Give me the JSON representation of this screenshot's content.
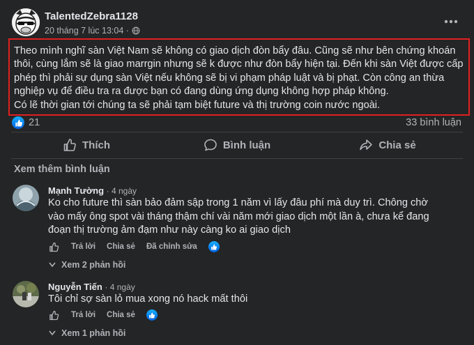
{
  "post": {
    "author": "TalentedZebra1128",
    "timestamp": "20 tháng 7 lúc 13:04 ·",
    "privacy_icon": "globe-icon",
    "more_icon": "more-horizontal-icon",
    "text_lines": [
      "Theo mình nghĩ sàn Việt Nam sẽ không có giao dịch đòn bẩy đâu. Cũng sẽ như bên chứng khoán",
      "thôi, cùng lắm sẽ là giao marrgin nhưng sẽ k được như đòn bẩy hiện tại. Đến khi sàn Việt được cấp",
      "phép thì phải sự dụng sàn Việt nếu không sẽ bị vi phạm pháp luật và bị phạt. Còn công an thừa",
      "nghiệp vụ để điều tra ra được bạn có đang dùng ứng dụng không hợp pháp không.",
      "Có lẽ thời gian tới chúng ta sẽ phải tạm biệt future và thị trường coin nước ngoài."
    ],
    "reaction_count": "21",
    "comment_count": "33 bình luận",
    "highlight_color": "#e02020"
  },
  "actions": {
    "like": "Thích",
    "comment": "Bình luận",
    "share": "Chia sẻ"
  },
  "see_more_comments": "Xem thêm bình luận",
  "comments": [
    {
      "name": "Mạnh Tường",
      "time": "· 4 ngày",
      "text_lines": [
        "Ko cho future thì sàn bảo đảm sập trong 1 năm vì lấy đâu phí mà duy trì. Chông chờ",
        "vào mấy ông spot vài tháng thậm chí vài năm mới giao dịch một lần à, chưa kể đang",
        "đoạn thị trường ảm đạm như này càng ko ai giao dịch"
      ],
      "reply": "Trả lời",
      "share": "Chia sẻ",
      "edited": "Đã chỉnh sửa",
      "replies": "Xem 2 phản hồi"
    },
    {
      "name": "Nguyễn Tiến",
      "time": "· 4 ngày",
      "text_lines": [
        "Tôi chỉ sợ sàn lỏ mua xong nó hack mất thôi"
      ],
      "reply": "Trả lời",
      "share": "Chia sẻ",
      "replies": "Xem 1 phản hồi"
    }
  ],
  "colors": {
    "background": "#242526",
    "text": "#e4e6eb",
    "secondary_text": "#b0b3b8",
    "like_blue": "#0062df"
  }
}
